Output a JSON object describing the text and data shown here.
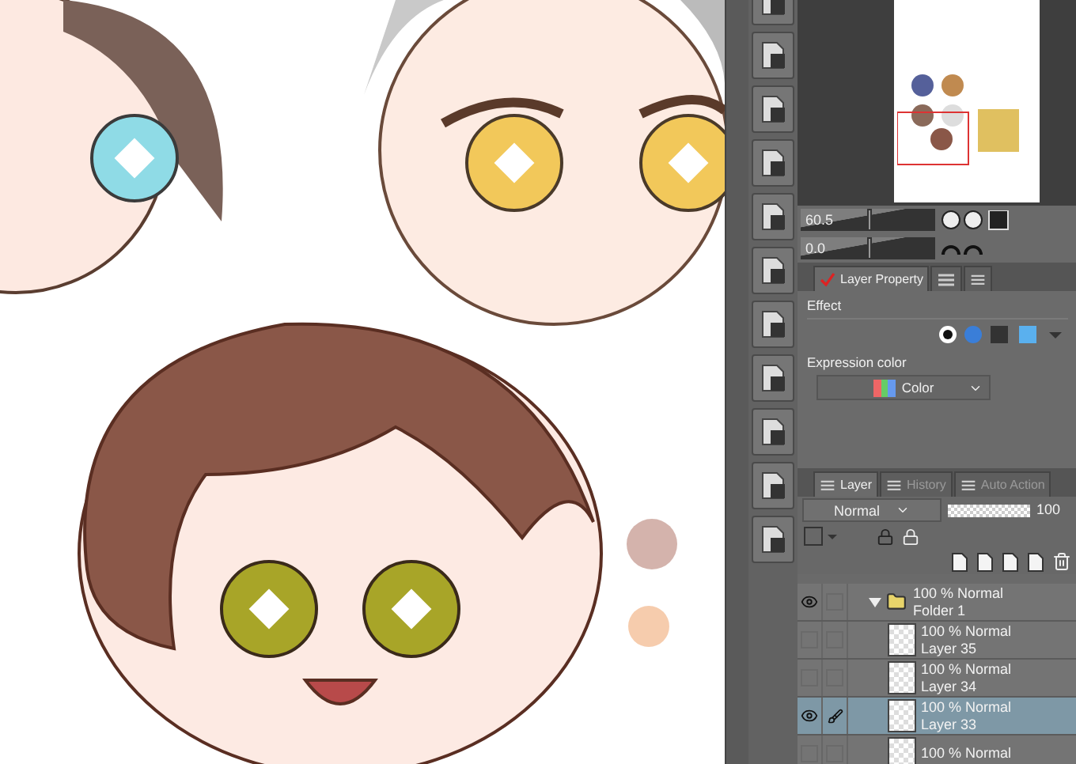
{
  "navigator": {
    "zoom": {
      "value": "60.5",
      "level": 0.5
    },
    "rotation": {
      "value": "0.0",
      "level": 0.5
    }
  },
  "property_tabs": [
    {
      "label": "Layer Property",
      "selected": true
    }
  ],
  "effect": {
    "label": "Effect"
  },
  "expression_color": {
    "label": "Expression color",
    "value": "Color"
  },
  "layer_tabs": [
    {
      "label": "Layer",
      "selected": true
    },
    {
      "label": "History",
      "selected": false
    },
    {
      "label": "Auto Action",
      "selected": false
    }
  ],
  "blend_mode": "Normal",
  "opacity": {
    "value": "100",
    "level": 1
  },
  "layers": [
    {
      "kind": "folder",
      "mode": "100 % Normal",
      "name": "Folder 1",
      "visible": true,
      "expanded": true,
      "selected": false,
      "editing": false,
      "children": [
        {
          "kind": "raster",
          "mode": "100 % Normal",
          "name": "Layer 35",
          "visible": false,
          "selected": false,
          "editing": false
        },
        {
          "kind": "raster",
          "mode": "100 % Normal",
          "name": "Layer 34",
          "visible": false,
          "selected": false,
          "editing": false
        },
        {
          "kind": "raster",
          "mode": "100 % Normal",
          "name": "Layer 33",
          "visible": true,
          "selected": true,
          "editing": true
        },
        {
          "kind": "raster",
          "mode": "100 % Normal",
          "visible": false,
          "selected": false,
          "editing": false
        }
      ]
    }
  ]
}
